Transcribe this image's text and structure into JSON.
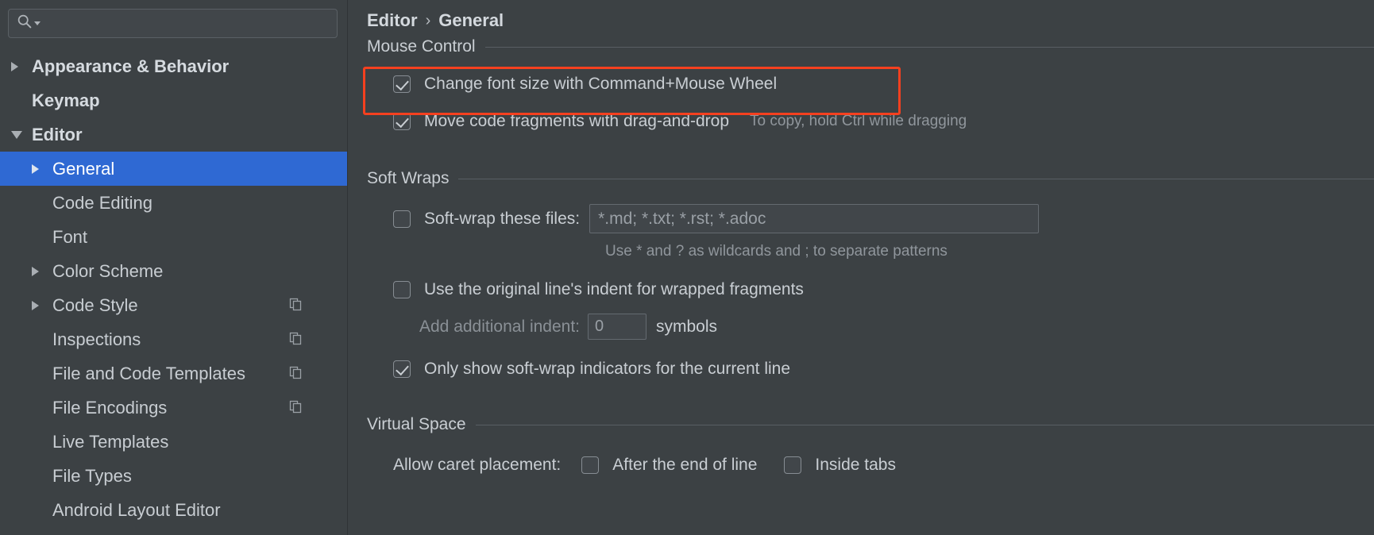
{
  "window": {
    "theme_bg": "#3c4144",
    "accent_selection": "#2f69d3",
    "annotation_color": "#f5401f"
  },
  "sidebar": {
    "search": {
      "value": "",
      "placeholder": "",
      "icon": "search-icon",
      "dropdown_icon": "chevron-down-icon"
    },
    "items": [
      {
        "label": "Appearance & Behavior",
        "indent": 0,
        "twisty": "collapsed",
        "bold": true,
        "selected": false,
        "copy_icon": false
      },
      {
        "label": "Keymap",
        "indent": 0,
        "twisty": "none",
        "bold": true,
        "selected": false,
        "copy_icon": false
      },
      {
        "label": "Editor",
        "indent": 0,
        "twisty": "expanded",
        "bold": true,
        "selected": false,
        "copy_icon": false
      },
      {
        "label": "General",
        "indent": 1,
        "twisty": "collapsed",
        "bold": false,
        "selected": true,
        "copy_icon": false
      },
      {
        "label": "Code Editing",
        "indent": 1,
        "twisty": "none",
        "bold": false,
        "selected": false,
        "copy_icon": false
      },
      {
        "label": "Font",
        "indent": 1,
        "twisty": "none",
        "bold": false,
        "selected": false,
        "copy_icon": false
      },
      {
        "label": "Color Scheme",
        "indent": 1,
        "twisty": "collapsed",
        "bold": false,
        "selected": false,
        "copy_icon": false
      },
      {
        "label": "Code Style",
        "indent": 1,
        "twisty": "collapsed",
        "bold": false,
        "selected": false,
        "copy_icon": true
      },
      {
        "label": "Inspections",
        "indent": 1,
        "twisty": "none",
        "bold": false,
        "selected": false,
        "copy_icon": true
      },
      {
        "label": "File and Code Templates",
        "indent": 1,
        "twisty": "none",
        "bold": false,
        "selected": false,
        "copy_icon": true
      },
      {
        "label": "File Encodings",
        "indent": 1,
        "twisty": "none",
        "bold": false,
        "selected": false,
        "copy_icon": true
      },
      {
        "label": "Live Templates",
        "indent": 1,
        "twisty": "none",
        "bold": false,
        "selected": false,
        "copy_icon": false
      },
      {
        "label": "File Types",
        "indent": 1,
        "twisty": "none",
        "bold": false,
        "selected": false,
        "copy_icon": false
      },
      {
        "label": "Android Layout Editor",
        "indent": 1,
        "twisty": "none",
        "bold": false,
        "selected": false,
        "copy_icon": false
      }
    ]
  },
  "breadcrumb": {
    "root": "Editor",
    "separator": "›",
    "leaf": "General"
  },
  "sections": {
    "mouse_control": {
      "title": "Mouse Control",
      "change_font_size": {
        "label": "Change font size with Command+Mouse Wheel",
        "checked": true,
        "highlighted": true
      },
      "move_code_fragments": {
        "label": "Move code fragments with drag-and-drop",
        "checked": true,
        "hint": "To copy, hold Ctrl while dragging"
      }
    },
    "soft_wraps": {
      "title": "Soft Wraps",
      "soft_wrap_files": {
        "label": "Soft-wrap these files:",
        "checked": false,
        "value": "*.md; *.txt; *.rst; *.adoc"
      },
      "wildcard_hint": "Use * and ? as wildcards and ; to separate patterns",
      "original_indent": {
        "label": "Use the original line's indent for wrapped fragments",
        "checked": false
      },
      "additional_indent": {
        "label": "Add additional indent:",
        "value": "0",
        "unit": "symbols"
      },
      "indicators_current_line": {
        "label": "Only show soft-wrap indicators for the current line",
        "checked": true
      }
    },
    "virtual_space": {
      "title": "Virtual Space",
      "caret_placement_label": "Allow caret placement:",
      "options": [
        {
          "label": "After the end of line",
          "checked": false
        },
        {
          "label": "Inside tabs",
          "checked": false
        }
      ]
    }
  }
}
